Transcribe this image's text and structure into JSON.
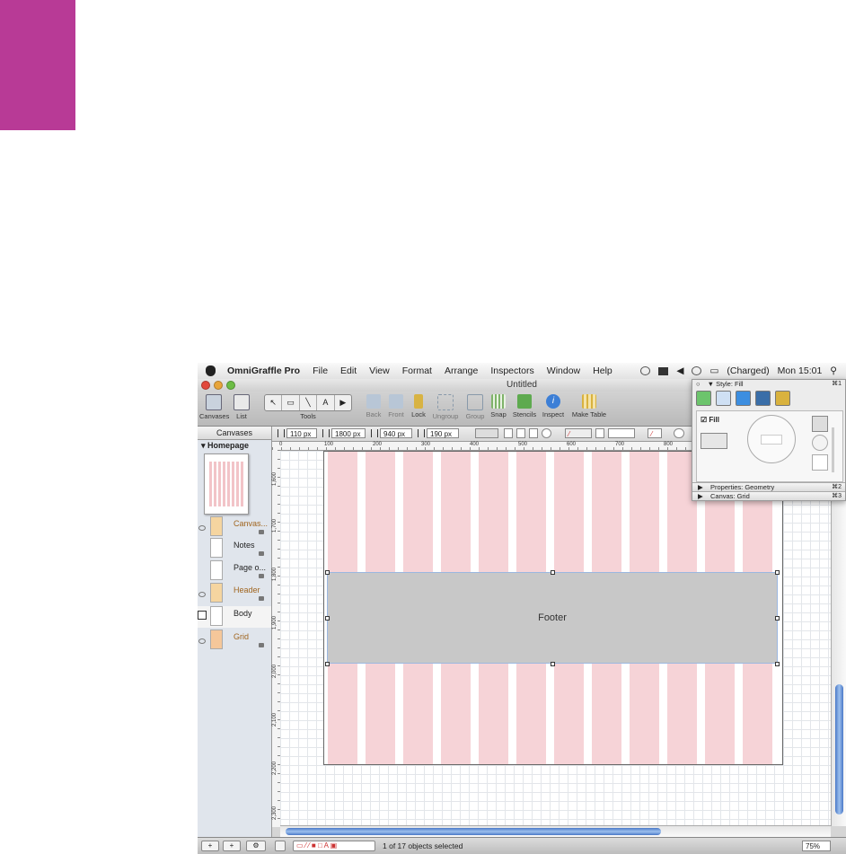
{
  "menubar": {
    "app_name": "OmniGraffle Pro",
    "items": [
      "File",
      "Edit",
      "View",
      "Format",
      "Arrange",
      "Inspectors",
      "Window",
      "Help"
    ],
    "battery": "(Charged)",
    "clock": "Mon 15:01"
  },
  "window": {
    "title": "Untitled",
    "toolbar": {
      "canvases": "Canvases",
      "list": "List",
      "tools": "Tools",
      "back": "Back",
      "front": "Front",
      "lock": "Lock",
      "ungroup": "Ungroup",
      "group": "Group",
      "snap": "Snap",
      "stencils": "Stencils",
      "inspect": "Inspect",
      "make_table": "Make Table"
    }
  },
  "sidebar": {
    "header": "Canvases",
    "canvas_name": "Homepage",
    "layers": [
      {
        "label": "Canvas...",
        "color": "#f5d5a0"
      },
      {
        "label": "Notes",
        "color": "#ffffff"
      },
      {
        "label": "Page o...",
        "color": "#ffffff"
      },
      {
        "label": "Header",
        "color": "#f5d5a0"
      },
      {
        "label": "Body",
        "color": "#ffffff"
      },
      {
        "label": "Grid",
        "color": "#f5c79a"
      }
    ]
  },
  "geometry": {
    "x": "110 px",
    "y": "1800 px",
    "width": "940 px",
    "height": "190 px"
  },
  "ruler": {
    "h_ticks": [
      "0",
      "100",
      "200",
      "300",
      "400",
      "500",
      "600",
      "700",
      "800"
    ],
    "v_ticks": [
      "1,600",
      "1,700",
      "1,800",
      "1,900",
      "2,000",
      "2,100",
      "2,200",
      "2,300"
    ]
  },
  "canvas": {
    "shape_label": "Footer"
  },
  "statusbar": {
    "status": "1 of 17 objects selected",
    "zoom": "75%"
  },
  "inspector": {
    "style_title": "Style: Fill",
    "style_shortcut": "⌘1",
    "fill_label": "Fill",
    "properties": "Properties: Geometry",
    "properties_shortcut": "⌘2",
    "canvas": "Canvas: Grid",
    "canvas_shortcut": "⌘3"
  },
  "colors": {
    "accent_magenta": "#b83a96",
    "grid_column": "#f6d3d7",
    "footer_fill": "#c8c8c8",
    "scroll_blue": "#4a78c7"
  }
}
